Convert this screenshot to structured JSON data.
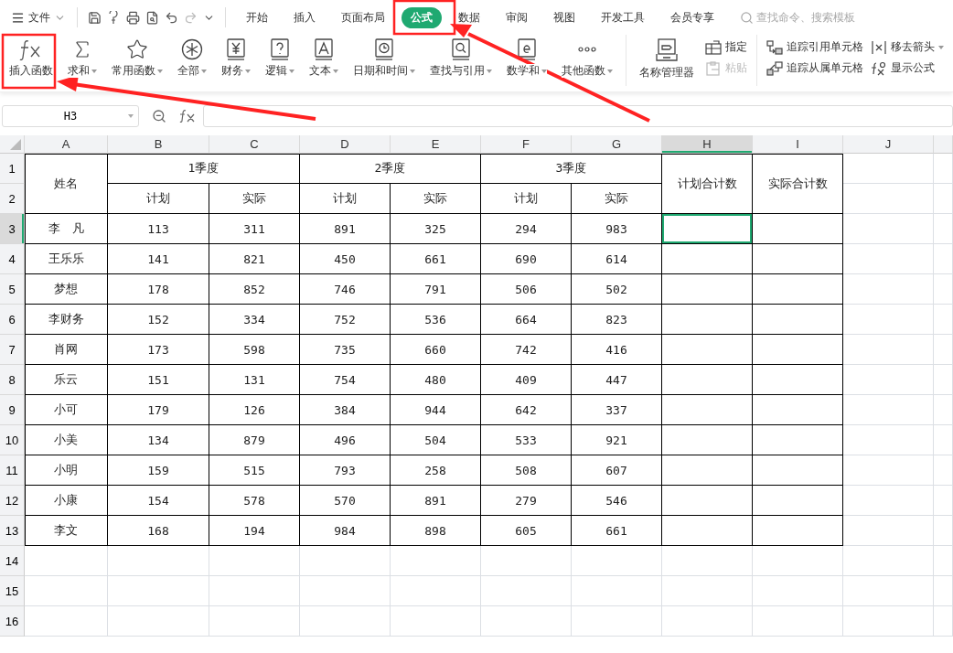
{
  "menu": {
    "file": "文件",
    "tabs": [
      {
        "label": "开始",
        "selected": false
      },
      {
        "label": "插入",
        "selected": false
      },
      {
        "label": "页面布局",
        "selected": false
      },
      {
        "label": "公式",
        "selected": true
      },
      {
        "label": "数据",
        "selected": false
      },
      {
        "label": "审阅",
        "selected": false
      },
      {
        "label": "视图",
        "selected": false
      },
      {
        "label": "开发工具",
        "selected": false
      },
      {
        "label": "会员专享",
        "selected": false
      }
    ],
    "search_placeholder": "查找命令、搜索模板"
  },
  "ribbon": {
    "functions": [
      {
        "label": "插入函数",
        "dropdown": false
      },
      {
        "label": "求和",
        "dropdown": true
      },
      {
        "label": "常用函数",
        "dropdown": true
      },
      {
        "label": "全部",
        "dropdown": true
      },
      {
        "label": "财务",
        "dropdown": true
      },
      {
        "label": "逻辑",
        "dropdown": true
      },
      {
        "label": "文本",
        "dropdown": true
      },
      {
        "label": "日期和时间",
        "dropdown": true
      },
      {
        "label": "查找与引用",
        "dropdown": true
      },
      {
        "label": "数学和",
        "dropdown": true
      },
      {
        "label": "其他函数",
        "dropdown": true
      }
    ],
    "name_manager": "名称管理器",
    "name_tools": [
      {
        "label": "指定",
        "disabled": false
      },
      {
        "label": "粘贴",
        "disabled": true
      }
    ],
    "audit": [
      {
        "label": "追踪引用单元格",
        "dropdown": false
      },
      {
        "label": "移去箭头",
        "dropdown": true
      },
      {
        "label": "追踪从属单元格",
        "dropdown": false
      },
      {
        "label": "显示公式",
        "dropdown": false
      }
    ]
  },
  "formula_bar": {
    "name_box": "H3"
  },
  "sheet": {
    "columns": [
      {
        "label": "A",
        "selected": false
      },
      {
        "label": "B",
        "selected": false
      },
      {
        "label": "C",
        "selected": false
      },
      {
        "label": "D",
        "selected": false
      },
      {
        "label": "E",
        "selected": false
      },
      {
        "label": "F",
        "selected": false
      },
      {
        "label": "G",
        "selected": false
      },
      {
        "label": "H",
        "selected": true
      },
      {
        "label": "I",
        "selected": false
      },
      {
        "label": "J",
        "selected": false
      }
    ],
    "row_numbers": [
      {
        "label": "1",
        "selected": false
      },
      {
        "label": "2",
        "selected": false
      },
      {
        "label": "3",
        "selected": true
      },
      {
        "label": "4",
        "selected": false
      },
      {
        "label": "5",
        "selected": false
      },
      {
        "label": "6",
        "selected": false
      },
      {
        "label": "7",
        "selected": false
      },
      {
        "label": "8",
        "selected": false
      },
      {
        "label": "9",
        "selected": false
      },
      {
        "label": "10",
        "selected": false
      },
      {
        "label": "11",
        "selected": false
      },
      {
        "label": "12",
        "selected": false
      },
      {
        "label": "13",
        "selected": false
      },
      {
        "label": "14",
        "selected": false
      },
      {
        "label": "15",
        "selected": false
      },
      {
        "label": "16",
        "selected": false
      }
    ],
    "header": {
      "name": "姓名",
      "quarters": [
        {
          "title": "1季度",
          "plan": "计划",
          "actual": "实际"
        },
        {
          "title": "2季度",
          "plan": "计划",
          "actual": "实际"
        },
        {
          "title": "3季度",
          "plan": "计划",
          "actual": "实际"
        }
      ],
      "totals": [
        "计划合计数",
        "实际合计数"
      ]
    },
    "rows": [
      {
        "name": "李　凡",
        "values": [
          "113",
          "311",
          "891",
          "325",
          "294",
          "983"
        ],
        "total_cells": [
          {
            "selected": true
          },
          {
            "selected": false
          }
        ]
      },
      {
        "name": "王乐乐",
        "values": [
          "141",
          "821",
          "450",
          "661",
          "690",
          "614"
        ],
        "total_cells": [
          {
            "selected": false
          },
          {
            "selected": false
          }
        ]
      },
      {
        "name": "梦想",
        "values": [
          "178",
          "852",
          "746",
          "791",
          "506",
          "502"
        ],
        "total_cells": [
          {
            "selected": false
          },
          {
            "selected": false
          }
        ]
      },
      {
        "name": "李财务",
        "values": [
          "152",
          "334",
          "752",
          "536",
          "664",
          "823"
        ],
        "total_cells": [
          {
            "selected": false
          },
          {
            "selected": false
          }
        ]
      },
      {
        "name": "肖网",
        "values": [
          "173",
          "598",
          "735",
          "660",
          "742",
          "416"
        ],
        "total_cells": [
          {
            "selected": false
          },
          {
            "selected": false
          }
        ]
      },
      {
        "name": "乐云",
        "values": [
          "151",
          "131",
          "754",
          "480",
          "409",
          "447"
        ],
        "total_cells": [
          {
            "selected": false
          },
          {
            "selected": false
          }
        ]
      },
      {
        "name": "小可",
        "values": [
          "179",
          "126",
          "384",
          "944",
          "642",
          "337"
        ],
        "total_cells": [
          {
            "selected": false
          },
          {
            "selected": false
          }
        ]
      },
      {
        "name": "小美",
        "values": [
          "134",
          "879",
          "496",
          "504",
          "533",
          "921"
        ],
        "total_cells": [
          {
            "selected": false
          },
          {
            "selected": false
          }
        ]
      },
      {
        "name": "小明",
        "values": [
          "159",
          "515",
          "793",
          "258",
          "508",
          "607"
        ],
        "total_cells": [
          {
            "selected": false
          },
          {
            "selected": false
          }
        ]
      },
      {
        "name": "小康",
        "values": [
          "154",
          "578",
          "570",
          "891",
          "279",
          "546"
        ],
        "total_cells": [
          {
            "selected": false
          },
          {
            "selected": false
          }
        ]
      },
      {
        "name": "李文",
        "values": [
          "168",
          "194",
          "984",
          "898",
          "605",
          "661"
        ],
        "total_cells": [
          {
            "selected": false
          },
          {
            "selected": false
          }
        ]
      }
    ]
  }
}
